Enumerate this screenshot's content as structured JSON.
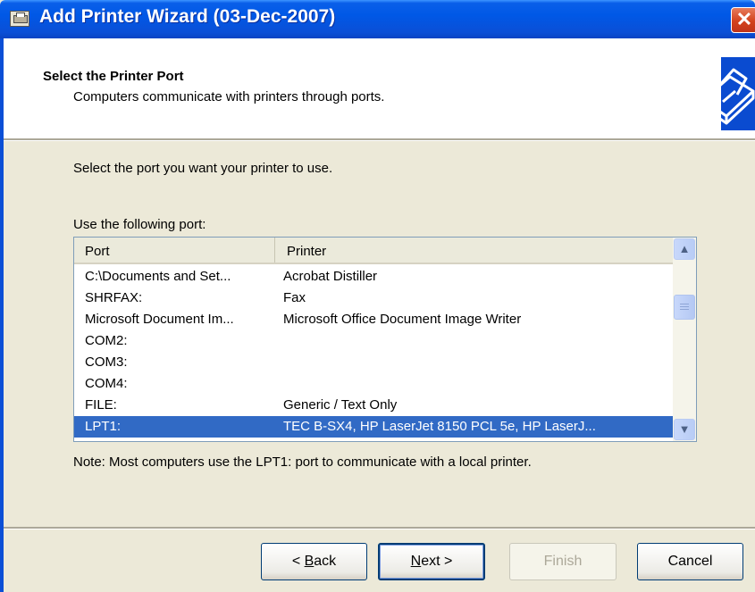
{
  "window": {
    "title": "Add Printer Wizard (03-Dec-2007)",
    "close_glyph": "✕"
  },
  "header": {
    "title": "Select the Printer Port",
    "subtitle": "Computers communicate with printers through ports.",
    "art_icon": "printer-icon"
  },
  "body": {
    "instruction": "Select the port you want your printer to use.",
    "list_label": "Use the following port:",
    "columns": {
      "port": "Port",
      "printer": "Printer"
    },
    "rows": [
      {
        "port": "C:\\Documents and Set...",
        "printer": "Acrobat Distiller",
        "selected": false
      },
      {
        "port": "SHRFAX:",
        "printer": "Fax",
        "selected": false
      },
      {
        "port": "Microsoft Document Im...",
        "printer": "Microsoft Office Document Image Writer",
        "selected": false
      },
      {
        "port": "COM2:",
        "printer": "",
        "selected": false
      },
      {
        "port": "COM3:",
        "printer": "",
        "selected": false
      },
      {
        "port": "COM4:",
        "printer": "",
        "selected": false
      },
      {
        "port": "FILE:",
        "printer": "Generic / Text Only",
        "selected": false
      },
      {
        "port": "LPT1:",
        "printer": "TEC B-SX4, HP LaserJet 8150 PCL 5e, HP LaserJ...",
        "selected": true
      }
    ],
    "note": "Note: Most computers use the LPT1: port to communicate with a local printer."
  },
  "buttons": {
    "back": {
      "prefix": "< ",
      "accel": "B",
      "rest": "ack"
    },
    "next": {
      "accel": "N",
      "rest": "ext >"
    },
    "finish": "Finish",
    "cancel": "Cancel"
  },
  "colors": {
    "titlebar": "#0058e6",
    "selection": "#316ac5",
    "dialog_bg": "#ece9d8"
  }
}
